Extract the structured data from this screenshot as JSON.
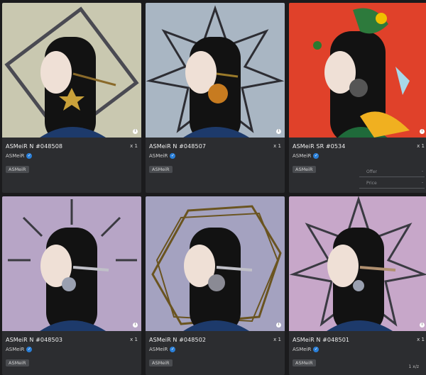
{
  "cards": [
    {
      "title": "ASMeiR N #048508",
      "qty": "x 1",
      "creator": "ASMeiR",
      "tag": "ASMeiR",
      "bg": "#c9c8b0"
    },
    {
      "title": "ASMeiR N #048507",
      "qty": "x 1",
      "creator": "ASMeiR",
      "tag": "ASMeiR",
      "bg": "#a9b6c3"
    },
    {
      "title": "ASMeiR SR #0534",
      "qty": "x 1",
      "creator": "ASMeiR",
      "tag": "ASMeiR",
      "bg": "#e0412a",
      "offer_placeholder": "Offer",
      "price_placeholder": "Price",
      "offer_value": "-",
      "price_value": "-"
    },
    {
      "title": "ASMeiR N #048503",
      "qty": "x 1",
      "creator": "ASMeiR",
      "tag": "ASMeiR",
      "bg": "#b7a5c6"
    },
    {
      "title": "ASMeiR N #048502",
      "qty": "x 1",
      "creator": "ASMeiR",
      "tag": "ASMeiR",
      "bg": "#a4a2c0"
    },
    {
      "title": "ASMeiR N #048501",
      "qty": "x 1",
      "creator": "ASMeiR",
      "tag": "ASMeiR",
      "bg": "#c7a7c9"
    }
  ],
  "fields": {
    "offer": "Offer",
    "price": "Price",
    "dash": "-"
  },
  "pager": "1 x/z",
  "verified_icon": "check-badge-icon"
}
